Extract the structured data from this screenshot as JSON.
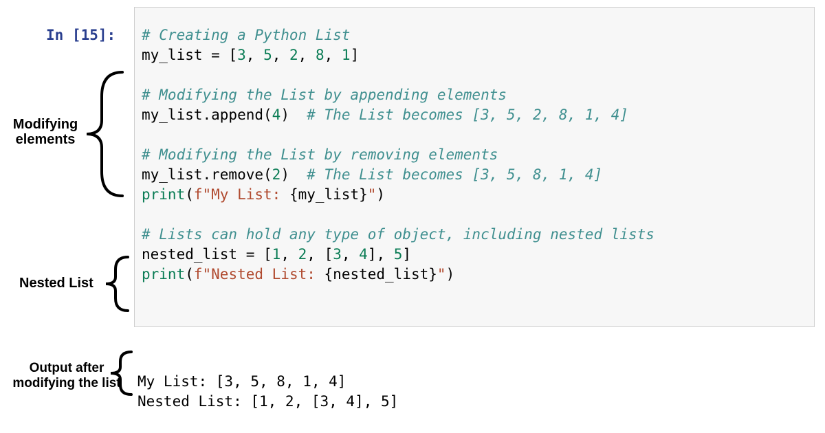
{
  "prompt": "In [15]:",
  "code": {
    "l1": "# Creating a Python List",
    "l2a": "my_list ",
    "l2b": "=",
    "l2c": " [",
    "l2d": "3",
    "l2e": ", ",
    "l2f": "5",
    "l2g": ", ",
    "l2h": "2",
    "l2i": ", ",
    "l2j": "8",
    "l2k": ", ",
    "l2l": "1",
    "l2m": "]",
    "l3": "",
    "l4": "# Modifying the List by appending elements",
    "l5a": "my_list.append(",
    "l5b": "4",
    "l5c": ")  ",
    "l5d": "# The List becomes [3, 5, 2, 8, 1, 4]",
    "l6": "",
    "l7": "# Modifying the List by removing elements",
    "l8a": "my_list.remove(",
    "l8b": "2",
    "l8c": ")  ",
    "l8d": "# The List becomes [3, 5, 8, 1, 4]",
    "l9a": "print",
    "l9b": "(",
    "l9c": "f\"My List: ",
    "l9d": "{my_list}",
    "l9e": "\"",
    "l9f": ")",
    "l10": "",
    "l11": "# Lists can hold any type of object, including nested lists",
    "l12a": "nested_list ",
    "l12b": "=",
    "l12c": " [",
    "l12d": "1",
    "l12e": ", ",
    "l12f": "2",
    "l12g": ", [",
    "l12h": "3",
    "l12i": ", ",
    "l12j": "4",
    "l12k": "], ",
    "l12l": "5",
    "l12m": "]",
    "l13a": "print",
    "l13b": "(",
    "l13c": "f\"Nested List: ",
    "l13d": "{nested_list}",
    "l13e": "\"",
    "l13f": ")"
  },
  "output": {
    "line1": "My List: [3, 5, 8, 1, 4]",
    "line2": "Nested List: [1, 2, [3, 4], 5]"
  },
  "annotations": {
    "modifying": "Modifying elements",
    "nested": "Nested List",
    "output": "Output after modifying the list"
  }
}
